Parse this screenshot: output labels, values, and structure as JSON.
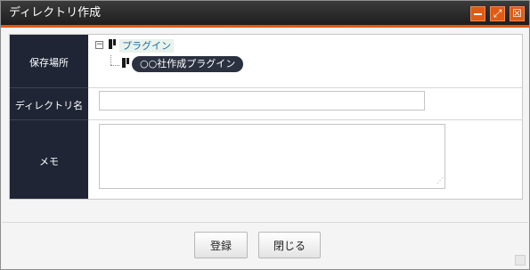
{
  "window": {
    "title": "ディレクトリ作成",
    "controls": {
      "minimize": "",
      "maximize": "⤢",
      "close": "☒"
    }
  },
  "form": {
    "location": {
      "label": "保存場所",
      "tree": {
        "root": {
          "label": "プラグイン",
          "toggle": "−"
        },
        "child": {
          "label": "○○社作成プラグイン"
        }
      }
    },
    "directory_name": {
      "label": "ディレクトリ名",
      "value": "",
      "placeholder": ""
    },
    "memo": {
      "label": "メモ",
      "value": "",
      "grip": "⋰"
    }
  },
  "footer": {
    "register_label": "登録",
    "close_label": "閉じる"
  },
  "colors": {
    "titlebar": "#2a2a2a",
    "accent": "#e05a14",
    "label_column": "#1f2535",
    "selected_node": "#2b3140",
    "link": "#1b6ea8"
  }
}
